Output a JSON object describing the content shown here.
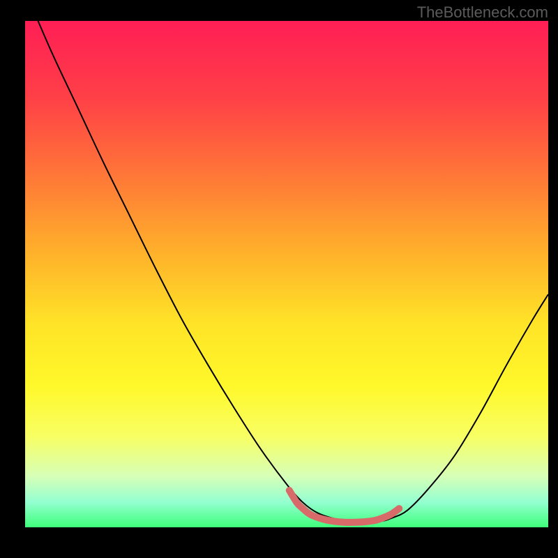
{
  "watermark": "TheBottleneck.com",
  "chart_data": {
    "type": "line",
    "title": "",
    "xlabel": "",
    "ylabel": "",
    "xlim": [
      0,
      100
    ],
    "ylim": [
      0,
      100
    ],
    "gradient_stops": [
      {
        "offset": 0,
        "color": "#ff1e55"
      },
      {
        "offset": 0.15,
        "color": "#ff3f47"
      },
      {
        "offset": 0.3,
        "color": "#ff7538"
      },
      {
        "offset": 0.45,
        "color": "#ffae2b"
      },
      {
        "offset": 0.6,
        "color": "#ffe427"
      },
      {
        "offset": 0.72,
        "color": "#fff82a"
      },
      {
        "offset": 0.82,
        "color": "#f8ff63"
      },
      {
        "offset": 0.9,
        "color": "#d6ffb8"
      },
      {
        "offset": 0.95,
        "color": "#94ffd1"
      },
      {
        "offset": 1.0,
        "color": "#3eff7a"
      }
    ],
    "series": [
      {
        "name": "bottleneck-curve",
        "color": "#000000",
        "width": 2,
        "x": [
          0.0,
          5,
          10,
          15,
          20,
          25,
          30,
          35,
          40,
          45,
          50,
          53,
          56,
          60,
          64,
          68,
          70,
          73,
          77,
          82,
          87,
          92,
          97,
          100
        ],
        "y": [
          106.0,
          94,
          83,
          72,
          61.5,
          51,
          41,
          32,
          23.5,
          15.5,
          8.5,
          5.0,
          2.8,
          1.5,
          1.0,
          1.2,
          1.8,
          3.3,
          7.5,
          14,
          22.5,
          32,
          41,
          46
        ]
      },
      {
        "name": "fit-band",
        "color": "#d86a6a",
        "width": 10,
        "linecap": "round",
        "x": [
          50.5,
          52,
          53,
          54,
          55,
          57,
          59,
          61,
          63,
          65,
          67,
          68.5,
          70,
          71.5
        ],
        "y": [
          7.3,
          4.8,
          3.8,
          2.9,
          2.3,
          1.6,
          1.2,
          1.0,
          1.0,
          1.1,
          1.4,
          1.9,
          2.6,
          3.7
        ]
      }
    ]
  }
}
